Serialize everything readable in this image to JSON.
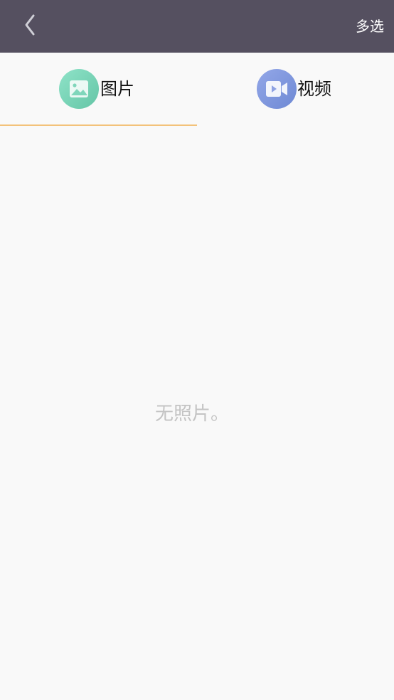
{
  "topbar": {
    "back_icon": "chevron-left-icon",
    "multi_select_label": "多选",
    "background": "#555060"
  },
  "tabs": [
    {
      "label": "图片",
      "icon": "image-icon",
      "active": true
    },
    {
      "label": "视频",
      "icon": "video-camera-icon",
      "active": false
    }
  ],
  "accent_color": "#f3c27a",
  "empty_state": {
    "message": "无照片。"
  }
}
